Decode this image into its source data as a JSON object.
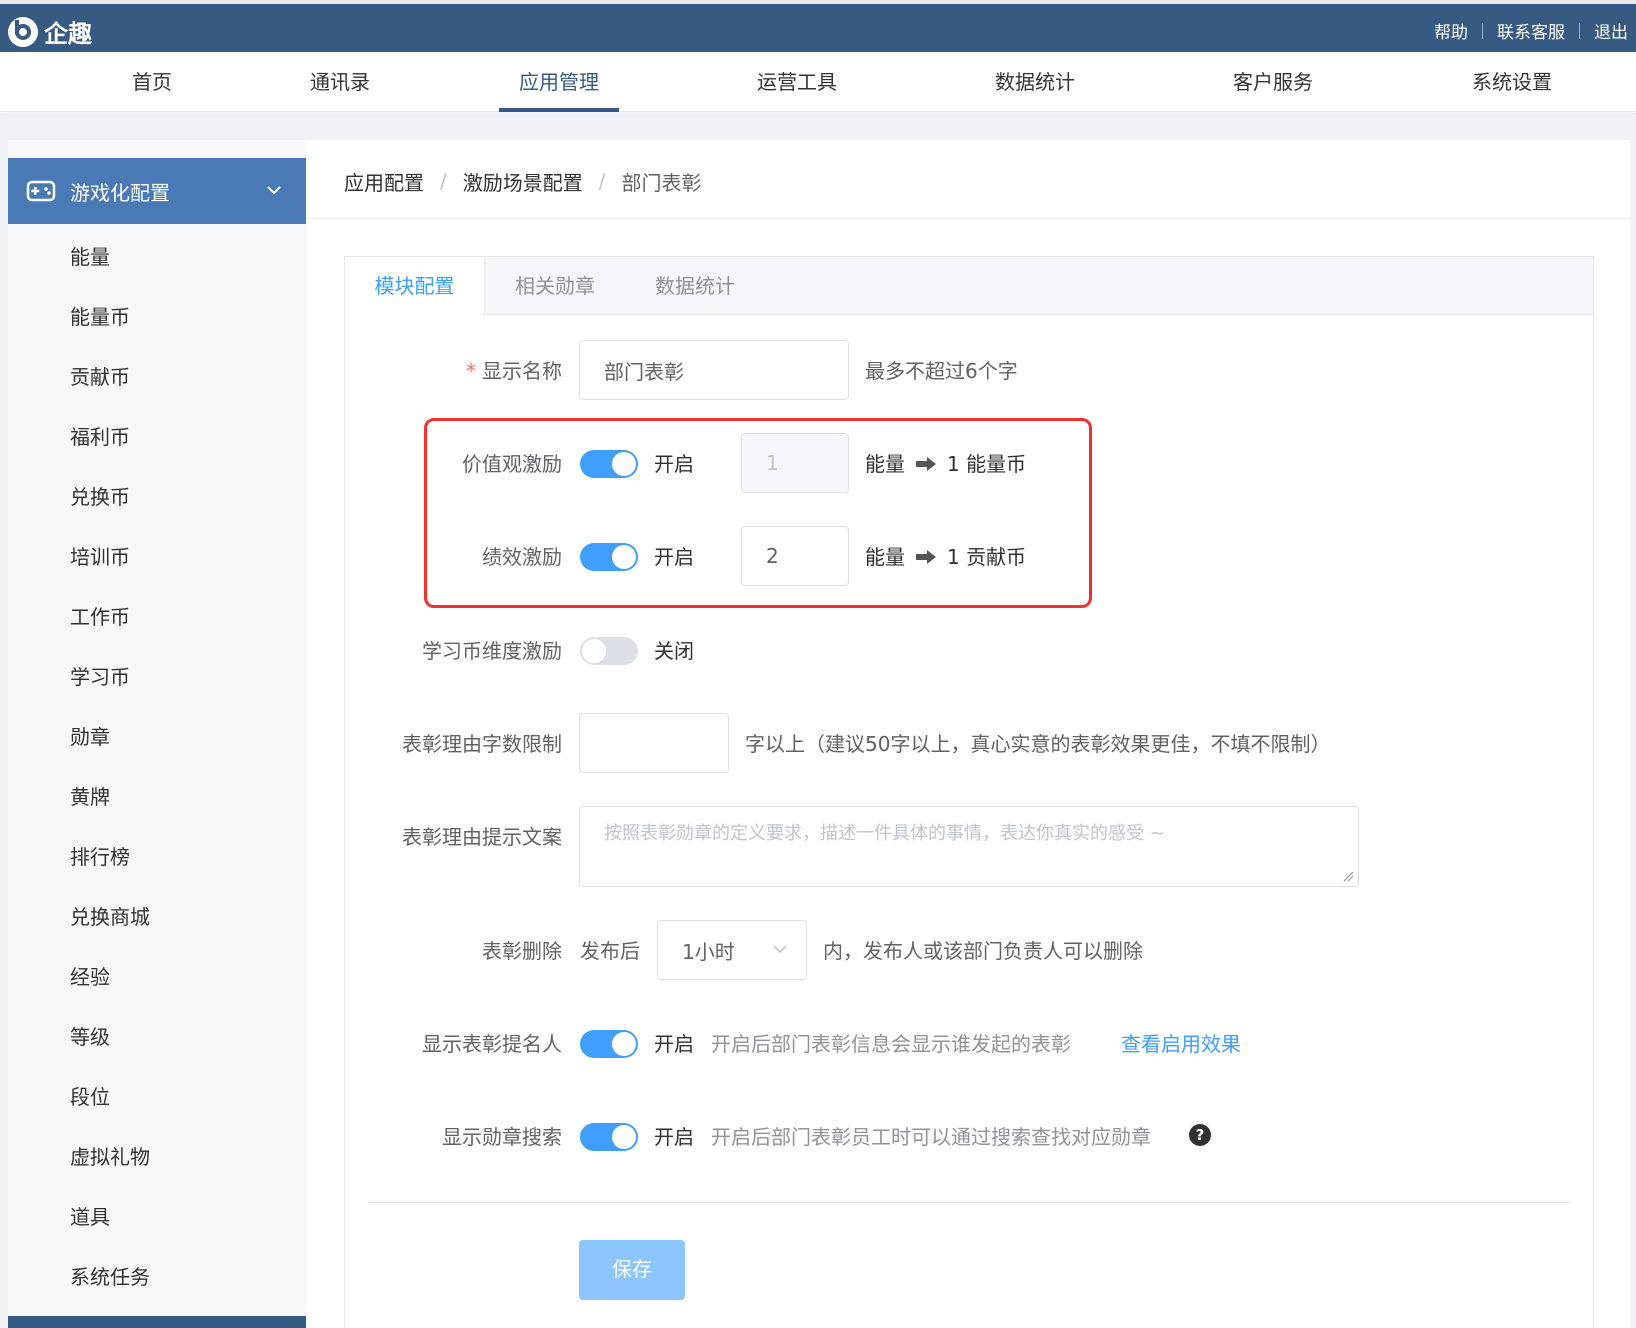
{
  "topbar": {
    "logo_text": "企趣",
    "links": [
      "帮助",
      "联系客服",
      "退出"
    ]
  },
  "mainnav": {
    "items": [
      "首页",
      "通讯录",
      "应用管理",
      "运营工具",
      "数据统计",
      "客户服务",
      "系统设置"
    ],
    "active": "应用管理"
  },
  "sidebar": {
    "header": "游戏化配置",
    "items": [
      "能量",
      "能量币",
      "贡献币",
      "福利币",
      "兑换币",
      "培训币",
      "工作币",
      "学习币",
      "勋章",
      "黄牌",
      "排行榜",
      "兑换商城",
      "经验",
      "等级",
      "段位",
      "虚拟礼物",
      "道具",
      "系统任务"
    ]
  },
  "breadcrumb": {
    "items": [
      "应用配置",
      "激励场景配置",
      "部门表彰"
    ],
    "separator": "/"
  },
  "tabs": {
    "items": [
      "模块配置",
      "相关勋章",
      "数据统计"
    ],
    "active": "模块配置"
  },
  "form": {
    "display_name": {
      "label": "显示名称",
      "required_mark": "*",
      "value": "部门表彰",
      "hint": "最多不超过6个字"
    },
    "value_incentive": {
      "label": "价值观激励",
      "switch_on": true,
      "switch_text": "开启",
      "amount": "1",
      "unit": "能量",
      "result": "1 能量币"
    },
    "performance_incentive": {
      "label": "绩效激励",
      "switch_on": true,
      "switch_text": "开启",
      "amount": "2",
      "unit": "能量",
      "result": "1 贡献币"
    },
    "study_coin_incentive": {
      "label": "学习币维度激励",
      "switch_on": false,
      "switch_text": "关闭"
    },
    "reason_length": {
      "label": "表彰理由字数限制",
      "value": "",
      "hint": "字以上（建议50字以上，真心实意的表彰效果更佳，不填不限制）"
    },
    "reason_prompt": {
      "label": "表彰理由提示文案",
      "placeholder": "按照表彰勋章的定义要求，描述一件具体的事情，表达你真实的感受 ~"
    },
    "delete_rule": {
      "label": "表彰删除",
      "prefix": "发布后",
      "selected": "1小时",
      "suffix": "内，发布人或该部门负责人可以删除"
    },
    "show_nominator": {
      "label": "显示表彰提名人",
      "switch_on": true,
      "switch_text": "开启",
      "hint": "开启后部门表彰信息会显示谁发起的表彰",
      "link": "查看启用效果"
    },
    "show_badge_search": {
      "label": "显示勋章搜索",
      "switch_on": true,
      "switch_text": "开启",
      "hint": "开启后部门表彰员工时可以通过搜索查找对应勋章",
      "help": "?"
    },
    "save_label": "保存"
  },
  "colors": {
    "topbar": "#375a82",
    "sidebar_active": "#4a7ab5",
    "primary": "#409eff",
    "highlight_box": "#f2312d"
  }
}
